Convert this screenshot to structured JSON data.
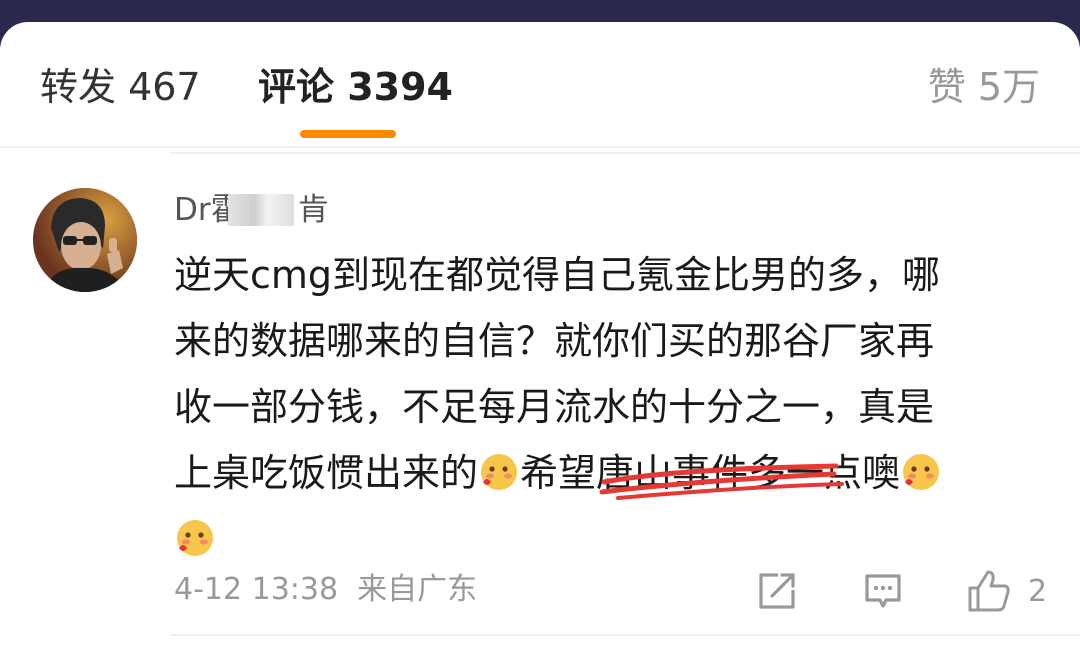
{
  "tabs": {
    "repost": "转发 467",
    "comment": "评论 3394",
    "like": "赞 5万"
  },
  "comment": {
    "username": "Dr霍",
    "username_suffix": "肯",
    "lines": [
      "逆天cmg到现在都觉得自己氪金比男的多，哪",
      "来的数据哪来的自信？就你们买的那谷厂家再",
      "收一部分钱，不足每月流水的十分之一，真是"
    ],
    "line4_a": "上桌吃饭惯出来的",
    "line4_b": "希望",
    "line4_strike": "唐山事件",
    "line4_c": "多一点噢",
    "time": "4-12 13:38",
    "source": "来自广东",
    "like_count": "2"
  },
  "icons": {
    "share": "share-icon",
    "reply": "comment-icon",
    "like": "thumbs-up-icon",
    "emoji": "shy-face-emoji-icon"
  },
  "colors": {
    "accent": "#ff8a00",
    "strike": "#e53935",
    "topbar": "#2b2850"
  }
}
